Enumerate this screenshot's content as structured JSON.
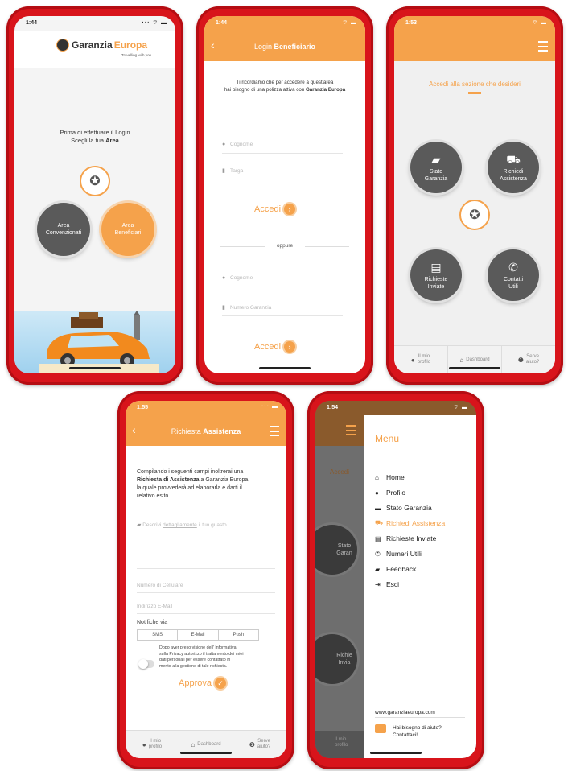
{
  "colors": {
    "accent": "#f5a24b",
    "frame": "#d8141b",
    "gray_circle": "#5a5a5a"
  },
  "s1": {
    "time": "1:44",
    "brand_a": "Garanzia",
    "brand_b": "Europa",
    "tagline": "Travelling with you",
    "prompt_line1": "Prima di effettuare il Login",
    "prompt_line2_pre": "Scegli la tua ",
    "prompt_line2_bold": "Area",
    "btn_conv_1": "Area",
    "btn_conv_2": "Convenzionati",
    "btn_benef_1": "Area",
    "btn_benef_2": "Beneficiari"
  },
  "s2": {
    "time": "1:44",
    "title_a": "Login ",
    "title_b": "Beneficiario",
    "intro_1": "Ti ricordiamo che per accedere a quest'area",
    "intro_2_pre": "hai bisogno di una polizza attiva con ",
    "intro_2_bold": "Garanzia Europa",
    "ph_cognome": "Cognome",
    "ph_targa": "Targa",
    "accedi": "Accedi",
    "oppure": "oppure",
    "ph_cognome2": "Cognome",
    "ph_numero": "Numero Garanzia",
    "accedi2": "Accedi"
  },
  "s3": {
    "time": "1:53",
    "heading": "Accedi alla sezione che desideri",
    "stato_1": "Stato",
    "stato_2": "Garanzia",
    "richiedi_1": "Richiedi",
    "richiedi_2": "Assistenza",
    "richieste_1": "Richieste",
    "richieste_2": "Inviate",
    "contatti_1": "Contatti",
    "contatti_2": "Utili",
    "tab_profilo_1": "Il mio",
    "tab_profilo_2": "profilo",
    "tab_dashboard": "Dashboard",
    "tab_aiuto_1": "Serve",
    "tab_aiuto_2": "aiuto?"
  },
  "s4": {
    "time": "1:55",
    "title_a": "Richiesta ",
    "title_b": "Assistenza",
    "p_1": "Compilando i seguenti campi inoltrerai una",
    "p_2_bold": "Richiesta di Assistenza",
    "p_2_rest": " a Garanzia Europa,",
    "p_3": "la quale provvederà ad elaborarla e darti il",
    "p_4": "relativo esito.",
    "desc_pre": "Descrivi ",
    "desc_link": "dettagliamente",
    "desc_post": " il tuo guasto",
    "ph_cell": "Numero di Cellulare",
    "ph_email": "Indirizzo E-Mail",
    "notifiche": "Notifiche via",
    "opt_sms": "SMS",
    "opt_email": "E-Mail",
    "opt_push": "Push",
    "privacy_1": "Dopo aver preso visione dell' Informativa",
    "privacy_2": "sulla Privacy autorizzo il trattamento dei miei",
    "privacy_3": "dati personali per essere contattato in",
    "privacy_4": "merito alla gestione di tale richiesta.",
    "approva": "Approva",
    "tab_profilo_1": "Il mio",
    "tab_profilo_2": "profilo",
    "tab_dashboard": "Dashboard",
    "tab_aiuto_1": "Serve",
    "tab_aiuto_2": "aiuto?"
  },
  "s5": {
    "time": "1:54",
    "menu_title": "Menu",
    "items": [
      {
        "label": "Home",
        "icon": "home-icon",
        "glyph": "⌂"
      },
      {
        "label": "Profilo",
        "icon": "user-icon",
        "glyph": "●"
      },
      {
        "label": "Stato Garanzia",
        "icon": "folder-icon",
        "glyph": "▬"
      },
      {
        "label": "Richiedi Assistenza",
        "icon": "car-icon",
        "glyph": "⛟"
      },
      {
        "label": "Richieste Inviate",
        "icon": "list-icon",
        "glyph": "▤"
      },
      {
        "label": "Numeri Utili",
        "icon": "phone-icon",
        "glyph": "✆"
      },
      {
        "label": "Feedback",
        "icon": "chat-icon",
        "glyph": "▰"
      },
      {
        "label": "Esci",
        "icon": "exit-icon",
        "glyph": "⇥"
      }
    ],
    "website": "www.garanziaeuropa.com",
    "help_1": "Hai bisogno di aiuto?",
    "help_2": "Contattaci!",
    "bg_partial_1": "Accedi",
    "bg_stato": "Stato",
    "bg_garan": "Garan",
    "bg_richi": "Richie",
    "bg_invia": "Invia",
    "bg_tab_1": "Il mio",
    "bg_tab_2": "profilo"
  }
}
